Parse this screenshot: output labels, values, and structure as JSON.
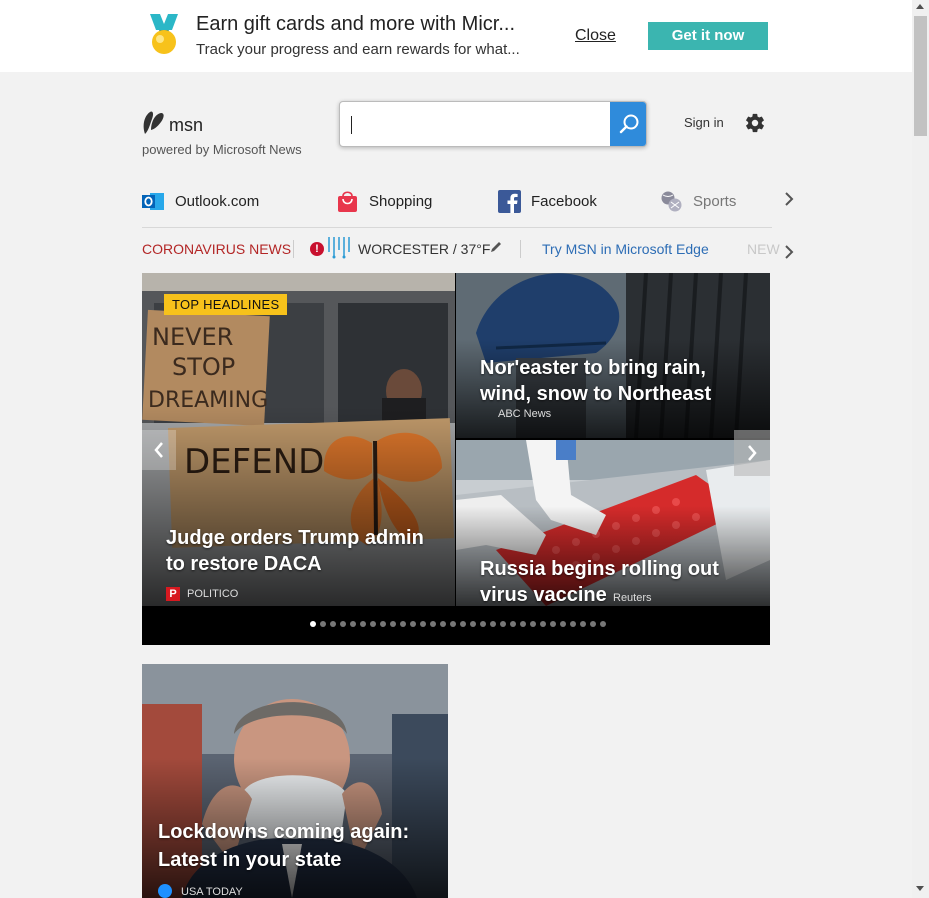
{
  "promo": {
    "title": "Earn gift cards and more with Micr...",
    "subtitle": "Track your progress and earn rewards for what...",
    "close_label": "Close",
    "cta_label": "Get it now",
    "icon": "medal-icon"
  },
  "header": {
    "logo_text": "msn",
    "powered_by": "powered by Microsoft News",
    "search": {
      "value": "",
      "placeholder": ""
    },
    "signin_label": "Sign in",
    "settings_icon": "gear-icon"
  },
  "quick_links": [
    {
      "label": "Outlook.com",
      "icon": "outlook-icon"
    },
    {
      "label": "Shopping",
      "icon": "shopping-bag-icon"
    },
    {
      "label": "Facebook",
      "icon": "facebook-icon"
    },
    {
      "label": "Sports",
      "icon": "sports-icon"
    }
  ],
  "news_strip": {
    "coronavirus": "CORONAVIRUS NEWS",
    "weather": "WORCESTER / 37°F",
    "edge_link": "Try MSN in Microsoft Edge",
    "news_fade": "NEW"
  },
  "carousel": {
    "badge": "TOP HEADLINES",
    "main": {
      "headline": "Judge orders Trump admin to restore DACA",
      "source": "POLITICO"
    },
    "top_right": {
      "headline": "Nor'easter to bring rain, wind, snow to Northeast",
      "source": "ABC News"
    },
    "bottom_right": {
      "headline": "Russia begins rolling out virus vaccine",
      "source": "Reuters"
    },
    "dot_count": 30,
    "active_dot": 0
  },
  "card": {
    "headline": "Lockdowns coming again: Latest in your state",
    "source": "USA TODAY"
  },
  "colors": {
    "accent": "#2f8bdb",
    "promo_cta": "#3bb5b0",
    "coronavirus": "#b32626",
    "badge": "#f7c21b",
    "link": "#2d6db5"
  }
}
